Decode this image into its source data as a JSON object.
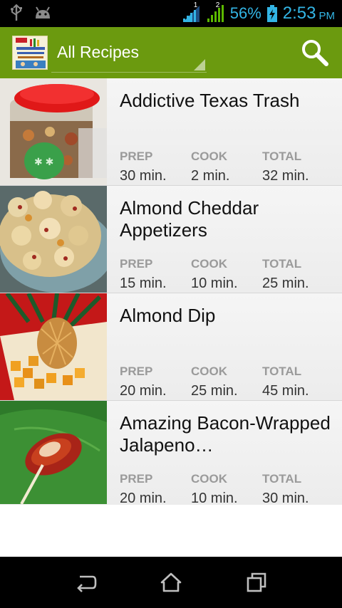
{
  "status_bar": {
    "battery": "56%",
    "time": "2:53",
    "ampm": "PM",
    "signal_1_label": "1",
    "signal_2_label": "2"
  },
  "action_bar": {
    "spinner_label": "All Recipes",
    "logo_icon": "cookbook-logo-icon",
    "search_icon": "search-icon"
  },
  "recipes": [
    {
      "title": "Addictive Texas Trash",
      "prep_label": "PREP",
      "cook_label": "COOK",
      "total_label": "TOTAL",
      "prep": "30 min.",
      "cook": "2 min.",
      "total": "32 min."
    },
    {
      "title": "Almond Cheddar Appetizers",
      "prep_label": "PREP",
      "cook_label": "COOK",
      "total_label": "TOTAL",
      "prep": "15 min.",
      "cook": "10 min.",
      "total": "25 min."
    },
    {
      "title": "Almond Dip",
      "prep_label": "PREP",
      "cook_label": "COOK",
      "total_label": "TOTAL",
      "prep": "20 min.",
      "cook": "25 min.",
      "total": "45 min."
    },
    {
      "title": "Amazing Bacon-Wrapped Jalapeno…",
      "prep_label": "PREP",
      "cook_label": "COOK",
      "total_label": "TOTAL",
      "prep": "20 min.",
      "cook": "10 min.",
      "total": "30 min."
    }
  ],
  "nav_bar": {
    "back_icon": "back-icon",
    "home_icon": "home-icon",
    "recents_icon": "recent-apps-icon"
  },
  "colors": {
    "action_bar": "#6b9a0f",
    "status_accent": "#33b5e5",
    "signal_green": "#5cb800"
  }
}
